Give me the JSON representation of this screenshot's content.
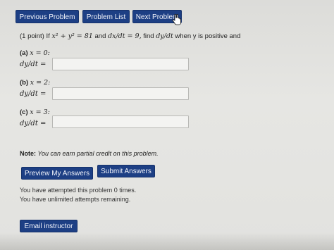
{
  "nav": {
    "previous_label": "Previous Problem",
    "list_label": "Problem List",
    "next_label": "Next Problem"
  },
  "problem": {
    "points": "(1 point) If",
    "equation": "x² + y² = 81",
    "and_text": "and",
    "rate": "dx/dt = 9,",
    "find_text": "find",
    "target": "dy/dt",
    "condition": "when y is positive and"
  },
  "parts": [
    {
      "label": "(a)",
      "condition": "x = 0:",
      "answer_label": "dy/dt =",
      "value": ""
    },
    {
      "label": "(b)",
      "condition": "x = 2:",
      "answer_label": "dy/dt =",
      "value": ""
    },
    {
      "label": "(c)",
      "condition": "x = 3:",
      "answer_label": "dy/dt =",
      "value": ""
    }
  ],
  "note": {
    "label": "Note:",
    "text": "You can earn partial credit on this problem."
  },
  "actions": {
    "preview_label": "Preview My Answers",
    "submit_label": "Submit Answers"
  },
  "status": {
    "attempts": "You have attempted this problem 0 times.",
    "remaining": "You have unlimited attempts remaining."
  },
  "footer": {
    "email_label": "Email instructor"
  },
  "colors": {
    "button": "#1d3f84",
    "background": "#e2e2df"
  }
}
